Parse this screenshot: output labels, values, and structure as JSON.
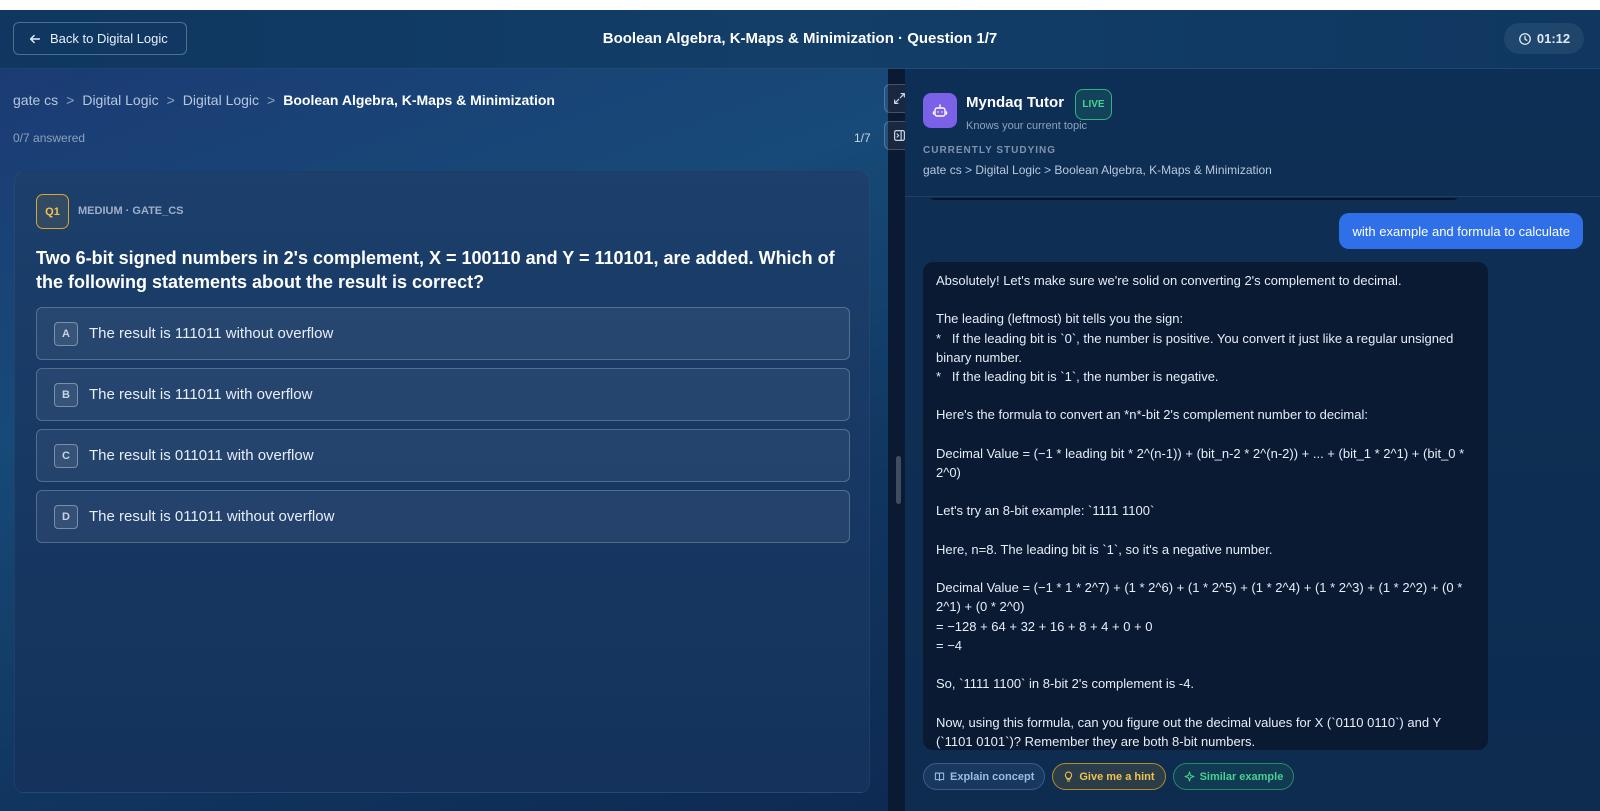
{
  "header": {
    "back_label": "Back to Digital Logic",
    "title": "Boolean Algebra, K-Maps & Minimization · Question 1/7",
    "timer": "01:12"
  },
  "breadcrumb": {
    "items": [
      "gate cs",
      "Digital Logic",
      "Digital Logic"
    ],
    "separator": ">",
    "current": "Boolean Algebra, K-Maps & Minimization"
  },
  "progress": {
    "answered": "0/7 answered",
    "page": "1/7"
  },
  "question": {
    "badge": "Q1",
    "meta": "MEDIUM · GATE_CS",
    "text": "Two 6-bit signed numbers in 2's complement, X = 100110 and Y = 110101, are added. Which of the following statements about the result is correct?",
    "options": [
      {
        "letter": "A",
        "text": "The result is 111011 without overflow"
      },
      {
        "letter": "B",
        "text": "The result is 111011 with overflow"
      },
      {
        "letter": "C",
        "text": "The result is 011011 with overflow"
      },
      {
        "letter": "D",
        "text": "The result is 011011 without overflow"
      }
    ]
  },
  "tutor": {
    "name": "Myndaq Tutor",
    "status": "LIVE",
    "subtitle": "Knows your current topic",
    "studying_label": "CURRENTLY STUDYING",
    "studying_path": "gate cs > Digital Logic > Boolean Algebra, K-Maps & Minimization"
  },
  "chat": {
    "user_message": "with example and formula to calculate",
    "bot_lines": [
      "Absolutely! Let's make sure we're solid on converting 2's complement to decimal.",
      "",
      "The leading (leftmost) bit tells you the sign:",
      "*   If the leading bit is `0`, the number is positive. You convert it just like a regular unsigned binary number.",
      "*   If the leading bit is `1`, the number is negative.",
      "",
      "Here's the formula to convert an *n*-bit 2's complement number to decimal:",
      "",
      "Decimal Value = (−1 * leading bit * 2^(n-1)) + (bit_n-2 * 2^(n-2)) + ... + (bit_1 * 2^1) + (bit_0 * 2^0)",
      "",
      "Let's try an 8-bit example: `1111 1100`",
      "",
      "Here, n=8. The leading bit is `1`, so it's a negative number.",
      "",
      "Decimal Value = (−1 * 1 * 2^7) + (1 * 2^6) + (1 * 2^5) + (1 * 2^4) + (1 * 2^3) + (1 * 2^2) + (0 * 2^1) + (0 * 2^0)",
      "= −128 + 64 + 32 + 16 + 8 + 4 + 0 + 0",
      "= −4",
      "",
      "So, `1111 1100` in 8-bit 2's complement is -4.",
      "",
      "Now, using this formula, can you figure out the decimal values for X (`0110 0110`) and Y (`1101 0101`)? Remember they are both 8-bit numbers."
    ],
    "actions": {
      "explain": "Explain concept",
      "hint": "Give me a hint",
      "similar": "Similar example"
    }
  }
}
